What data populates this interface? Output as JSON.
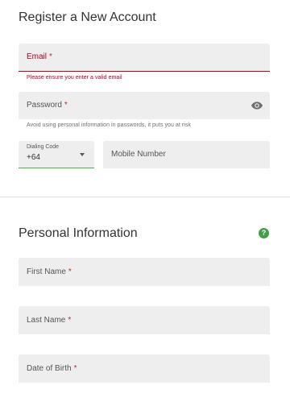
{
  "register": {
    "title": "Register a New Account",
    "email": {
      "label": "Email",
      "required_mark": "*",
      "error": "Please ensure you enter a valid email"
    },
    "password": {
      "label": "Password",
      "required_mark": "*",
      "hint": "Avoid using personal information in passwords, it puts you at risk",
      "icon": "eye-icon"
    },
    "dialing_code": {
      "label": "Dialing Code",
      "value": "+64",
      "icon": "chevron-down-icon"
    },
    "mobile": {
      "placeholder": "Mobile Number"
    }
  },
  "personal": {
    "title": "Personal Information",
    "help_icon": "?",
    "first_name": {
      "label": "First Name",
      "required_mark": "*"
    },
    "last_name": {
      "label": "Last Name",
      "required_mark": "*"
    },
    "dob": {
      "label": "Date of Birth",
      "required_mark": "*"
    }
  },
  "colors": {
    "error": "#b00020",
    "accent_green": "#43a047",
    "field_bg": "#eeeeee"
  }
}
